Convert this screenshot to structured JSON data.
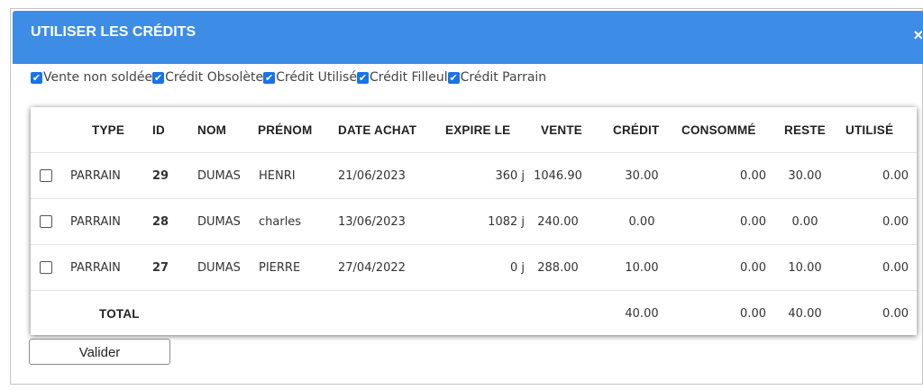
{
  "dialog": {
    "title": "UTILISER LES CRÉDITS",
    "close": "×"
  },
  "filters": [
    {
      "label": "Vente non soldée",
      "checked": true
    },
    {
      "label": "Crédit Obsolète",
      "checked": true
    },
    {
      "label": "Crédit Utilisé",
      "checked": true
    },
    {
      "label": "Crédit Filleul",
      "checked": true
    },
    {
      "label": "Crédit Parrain",
      "checked": true
    }
  ],
  "table": {
    "headers": {
      "type": "TYPE",
      "id": "ID",
      "nom": "NOM",
      "prenom": "PRÉNOM",
      "date_achat": "DATE ACHAT",
      "expire": "EXPIRE LE",
      "vente": "VENTE",
      "credit": "CRÉDIT",
      "consomme": "CONSOMMÉ",
      "reste": "RESTE",
      "utilise": "UTILISÉ"
    },
    "rows": [
      {
        "type": "PARRAIN",
        "id": "29",
        "nom": "DUMAS",
        "prenom": "HENRI",
        "date_achat": "21/06/2023",
        "expire": "360 j",
        "vente": "1046.90",
        "credit": "30.00",
        "consomme": "0.00",
        "reste": "30.00",
        "utilise": "0.00"
      },
      {
        "type": "PARRAIN",
        "id": "28",
        "nom": "DUMAS",
        "prenom": "charles",
        "date_achat": "13/06/2023",
        "expire": "1082 j",
        "vente": "240.00",
        "credit": "0.00",
        "consomme": "0.00",
        "reste": "0.00",
        "utilise": "0.00"
      },
      {
        "type": "PARRAIN",
        "id": "27",
        "nom": "DUMAS",
        "prenom": "PIERRE",
        "date_achat": "27/04/2022",
        "expire": "0 j",
        "vente": "288.00",
        "credit": "10.00",
        "consomme": "0.00",
        "reste": "10.00",
        "utilise": "0.00"
      }
    ],
    "total": {
      "label": "TOTAL",
      "credit": "40.00",
      "consomme": "0.00",
      "reste": "40.00",
      "utilise": "0.00"
    }
  },
  "actions": {
    "validate": "Valider"
  },
  "colors": {
    "titlebar": "#3d8ce5",
    "checkbox": "#1a73e8"
  },
  "icons": {
    "close": "close-icon",
    "checked": "checkmark-icon"
  }
}
